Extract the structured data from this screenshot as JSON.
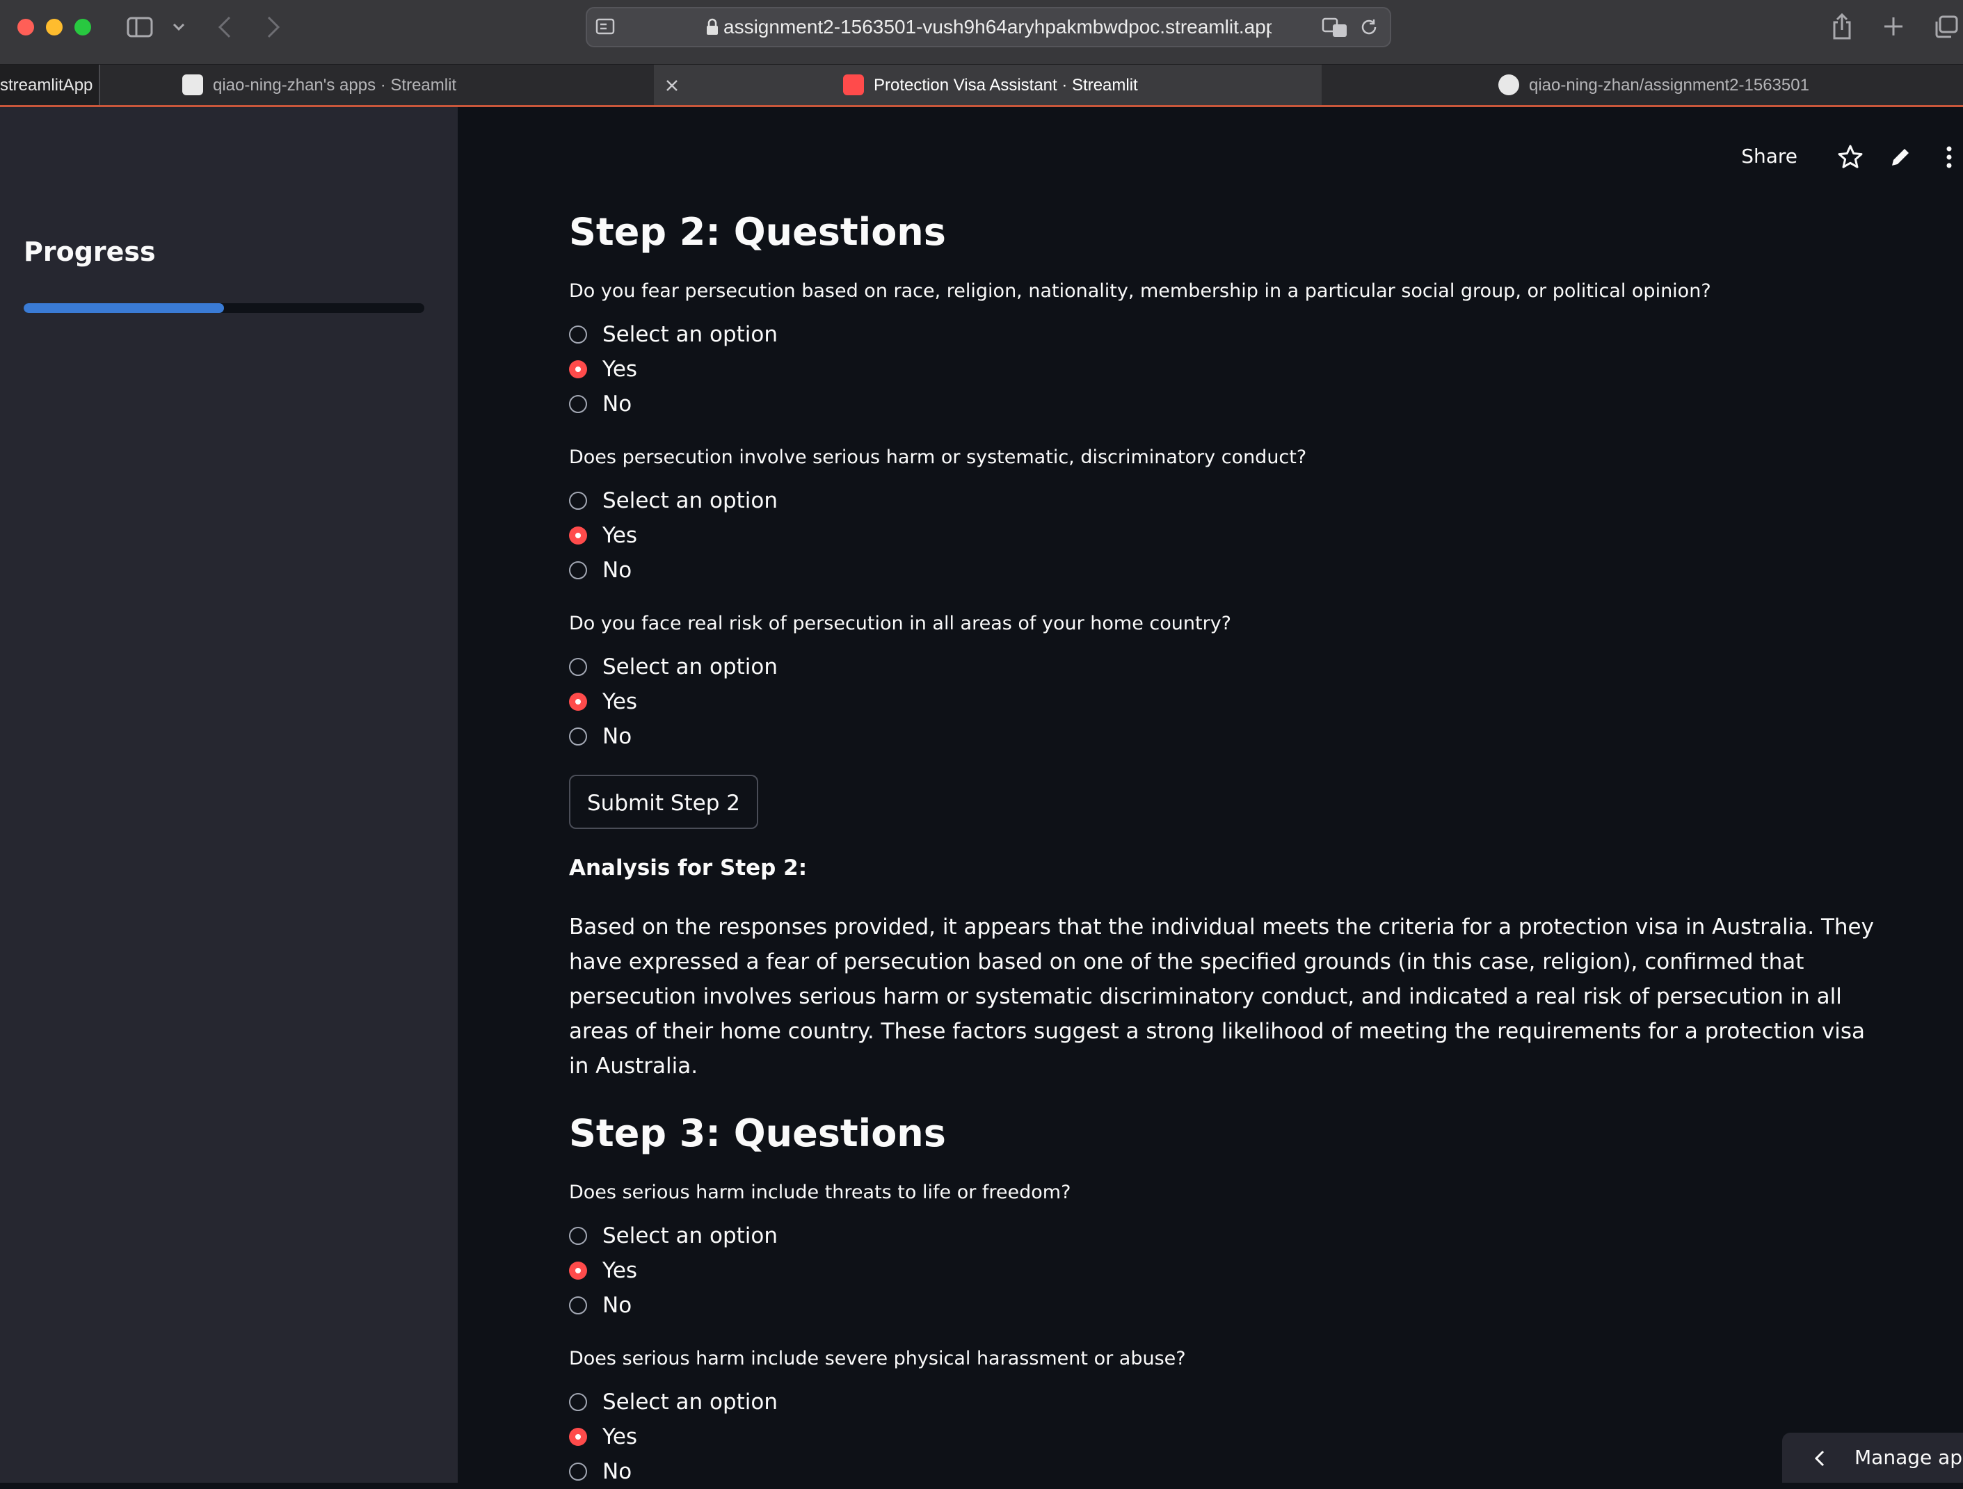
{
  "browser": {
    "url": "assignment2-1563501-vush9h64aryhpakmbwdpoc.streamlit.app",
    "tabs": [
      {
        "label": "streamlitApp"
      },
      {
        "label": "qiao-ning-zhan's apps · Streamlit"
      },
      {
        "label": "Protection Visa Assistant · Streamlit",
        "active": true
      },
      {
        "label": "qiao-ning-zhan/assignment2-1563501"
      }
    ]
  },
  "sidebar": {
    "title": "Progress",
    "progress": 0.5
  },
  "toolbar": {
    "share_label": "Share"
  },
  "sections": [
    {
      "heading": "Step 2: Questions",
      "questions": [
        {
          "text": "Do you fear persecution based on race, religion, nationality, membership in a particular social group, or political opinion?",
          "options": [
            "Select an option",
            "Yes",
            "No"
          ],
          "selected": 1
        },
        {
          "text": "Does persecution involve serious harm or systematic, discriminatory conduct?",
          "options": [
            "Select an option",
            "Yes",
            "No"
          ],
          "selected": 1
        },
        {
          "text": "Do you face real risk of persecution in all areas of your home country?",
          "options": [
            "Select an option",
            "Yes",
            "No"
          ],
          "selected": 1
        }
      ],
      "submit_label": "Submit Step 2",
      "analysis_title": "Analysis for Step 2:",
      "analysis_body": "Based on the responses provided, it appears that the individual meets the criteria for a protection visa in Australia. They have expressed a fear of persecution based on one of the specified grounds (in this case, religion), confirmed that persecution involves serious harm or systematic discriminatory conduct, and indicated a real risk of persecution in all areas of their home country. These factors suggest a strong likelihood of meeting the requirements for a protection visa in Australia."
    },
    {
      "heading": "Step 3: Questions",
      "questions": [
        {
          "text": "Does serious harm include threats to life or freedom?",
          "options": [
            "Select an option",
            "Yes",
            "No"
          ],
          "selected": 1
        },
        {
          "text": "Does serious harm include severe physical harassment or abuse?",
          "options": [
            "Select an option",
            "Yes",
            "No"
          ],
          "selected": 1
        }
      ]
    }
  ],
  "manage_app_label": "Manage app",
  "colors": {
    "accent": "#ff4b4b",
    "progress": "#3a7bd5",
    "sidebar_bg": "#262730",
    "main_bg": "#0e1117"
  }
}
